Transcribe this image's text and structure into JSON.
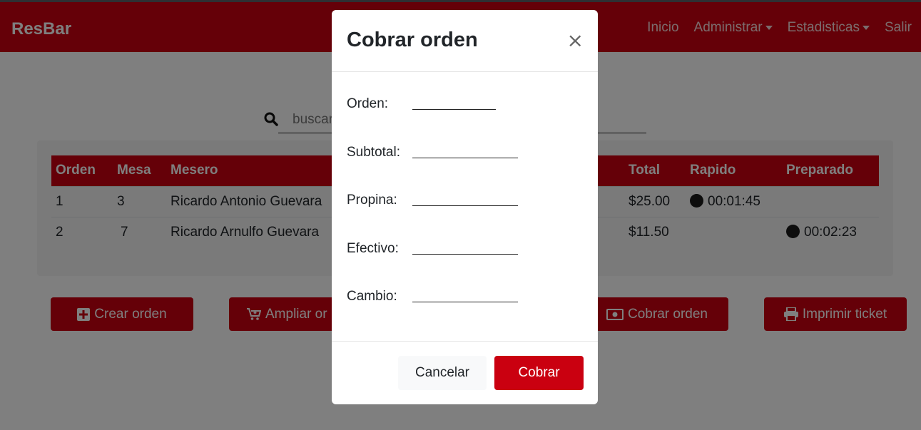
{
  "navbar": {
    "brand": "ResBar",
    "items": [
      {
        "label": "Inicio",
        "dropdown": false
      },
      {
        "label": "Administrar",
        "dropdown": true
      },
      {
        "label": "Estadisticas",
        "dropdown": true
      },
      {
        "label": "Salir",
        "dropdown": false
      }
    ]
  },
  "search": {
    "placeholder": "buscar",
    "icon": "search-icon"
  },
  "table": {
    "columns": [
      "Orden",
      "Mesa",
      "Mesero",
      "Total",
      "Rapido",
      "Preparado"
    ],
    "rows": [
      {
        "orden": "1",
        "mesa": "3",
        "mesero": "Ricardo Antonio Guevara",
        "total": "$25.00",
        "rapido": "00:01:45",
        "preparado": ""
      },
      {
        "orden": "2",
        "mesa": "7",
        "mesero": "Ricardo Arnulfo Guevara",
        "total": "$11.50",
        "rapido": "",
        "preparado": "00:02:23"
      }
    ]
  },
  "actions": {
    "crear": "Crear orden",
    "ampliar": "Ampliar or",
    "cobrar": "Cobrar orden",
    "imprimir": "Imprimir ticket"
  },
  "modal": {
    "title": "Cobrar orden",
    "close": "×",
    "fields": {
      "orden": "Orden:",
      "subtotal": "Subtotal:",
      "propina": "Propina:",
      "efectivo": "Efectivo:",
      "cambio": "Cambio:"
    },
    "cancel": "Cancelar",
    "submit": "Cobrar"
  },
  "colors": {
    "brand": "#ca0010",
    "overlay": "rgba(0,0,0,0.5)"
  }
}
